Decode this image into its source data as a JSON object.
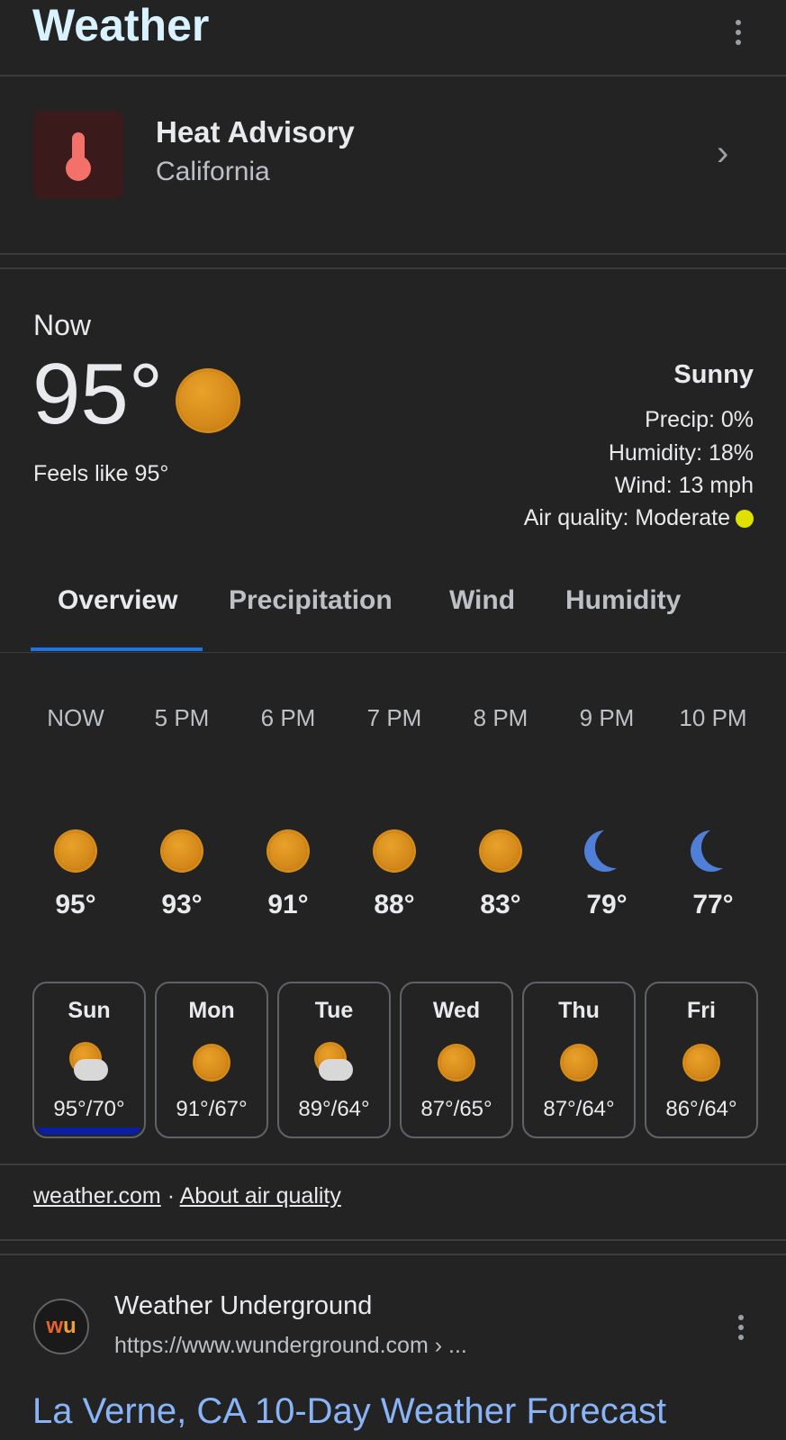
{
  "header": {
    "title": "Weather"
  },
  "alert": {
    "title": "Heat Advisory",
    "subtitle": "California"
  },
  "current": {
    "label": "Now",
    "temp": "95°",
    "condition": "Sunny",
    "feels_like": "Feels like 95°",
    "precip": "Precip: 0%",
    "humidity": "Humidity: 18%",
    "wind": "Wind: 13 mph",
    "air_quality": "Air quality: Moderate",
    "air_quality_color": "#e0e000"
  },
  "tabs": [
    {
      "label": "Overview",
      "active": true
    },
    {
      "label": "Precipitation"
    },
    {
      "label": "Wind"
    },
    {
      "label": "Humidity"
    }
  ],
  "accent": "#1a73e8",
  "hourly": [
    {
      "time": "NOW",
      "icon": "sun-icon",
      "temp": "95°"
    },
    {
      "time": "5 PM",
      "icon": "sun-icon",
      "temp": "93°"
    },
    {
      "time": "6 PM",
      "icon": "sun-icon",
      "temp": "91°"
    },
    {
      "time": "7 PM",
      "icon": "sun-icon",
      "temp": "88°"
    },
    {
      "time": "8 PM",
      "icon": "sun-icon",
      "temp": "83°"
    },
    {
      "time": "9 PM",
      "icon": "moon-icon",
      "temp": "79°"
    },
    {
      "time": "10 PM",
      "icon": "moon-icon",
      "temp": "77°"
    }
  ],
  "daily": [
    {
      "day": "Sun",
      "icon": "partly-cloudy-icon",
      "temps": "95°/70°",
      "selected": true
    },
    {
      "day": "Mon",
      "icon": "sun-icon",
      "temps": "91°/67°"
    },
    {
      "day": "Tue",
      "icon": "partly-cloudy-icon",
      "temps": "89°/64°"
    },
    {
      "day": "Wed",
      "icon": "sun-icon",
      "temps": "87°/65°"
    },
    {
      "day": "Thu",
      "icon": "sun-icon",
      "temps": "87°/64°"
    },
    {
      "day": "Fri",
      "icon": "sun-icon",
      "temps": "86°/64°"
    }
  ],
  "footer": {
    "source": "weather.com",
    "separator": "·",
    "about": "About air quality"
  },
  "result": {
    "site": "Weather Underground",
    "url": "https://www.wunderground.com › ...",
    "title": "La Verne, CA 10-Day Weather Forecast",
    "logo_text": "wu"
  }
}
